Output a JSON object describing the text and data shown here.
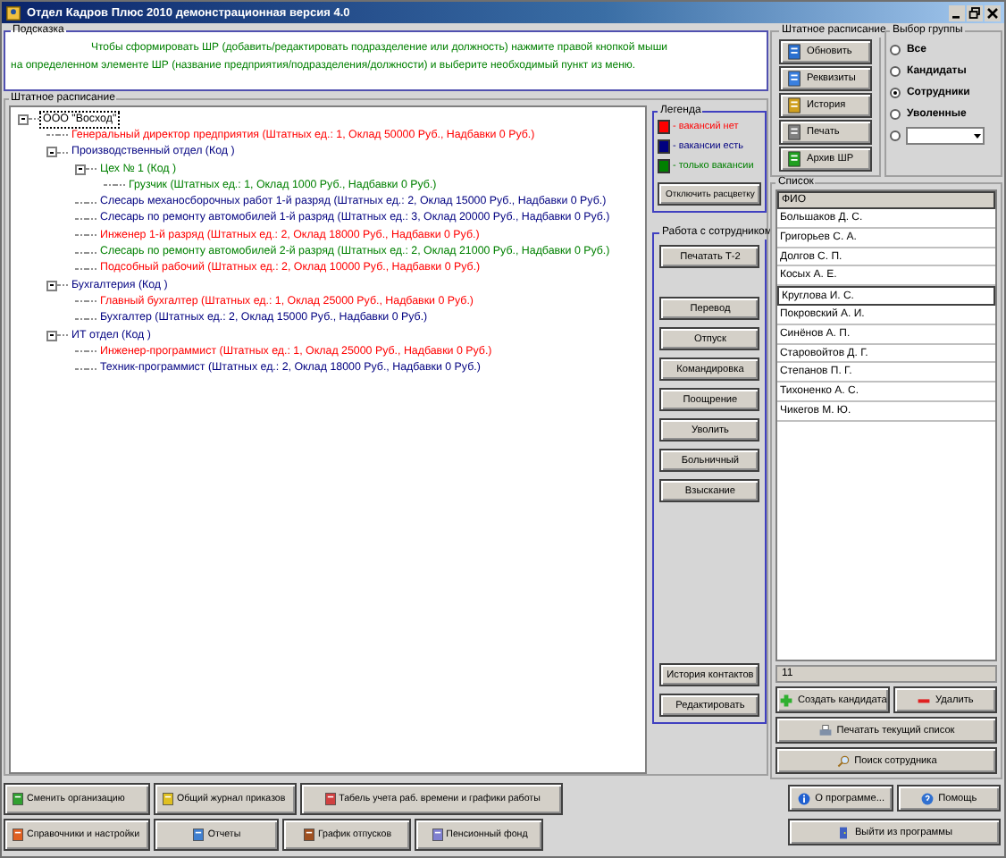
{
  "window": {
    "title": "Отдел Кадров Плюс 2010 демонстрационная версия 4.0"
  },
  "hint": {
    "title": "Подсказка",
    "text": "Чтобы сформировать ШР (добавить/редактировать подразделение или должность) нажмите правой кнопкой мыши на определенном элементе ШР (название предприятия/подразделения/должности) и выберите необходимый пункт из меню."
  },
  "staffing": {
    "title": "Штатное расписание",
    "tree": [
      {
        "label": "ООО \"Восход\"",
        "color": "#000000",
        "selected": true,
        "expanded": true,
        "children": [
          {
            "label": "Генеральный директор предприятия (Штатных ед.: 1, Оклад 50000 Руб., Надбавки 0 Руб.)",
            "color": "#ff0000",
            "selected": false
          },
          {
            "label": "Производственный отдел (Код )",
            "color": "#000080",
            "selected": false,
            "expanded": true,
            "children": [
              {
                "label": "Цех № 1 (Код )",
                "color": "#008000",
                "selected": false,
                "expanded": true,
                "children": [
                  {
                    "label": "Грузчик (Штатных ед.: 1, Оклад 1000 Руб., Надбавки 0 Руб.)",
                    "color": "#008000",
                    "selected": false
                  }
                ]
              },
              {
                "label": "Слесарь механосборочных работ 1-й разряд (Штатных ед.: 2, Оклад 15000 Руб., Надбавки 0 Руб.)",
                "color": "#000080",
                "selected": false
              },
              {
                "label": "Слесарь по ремонту автомобилей 1-й разряд (Штатных ед.: 3, Оклад 20000 Руб., Надбавки 0 Руб.)",
                "color": "#000080",
                "selected": false
              },
              {
                "label": "Инженер 1-й разряд (Штатных ед.: 2, Оклад 18000 Руб., Надбавки 0 Руб.)",
                "color": "#ff0000",
                "selected": false
              },
              {
                "label": "Слесарь по ремонту автомобилей 2-й разряд (Штатных ед.: 2, Оклад 21000 Руб., Надбавки 0 Руб.)",
                "color": "#008000",
                "selected": false
              },
              {
                "label": "Подсобный рабочий (Штатных ед.: 2, Оклад 10000 Руб., Надбавки 0 Руб.)",
                "color": "#ff0000",
                "selected": false
              }
            ]
          },
          {
            "label": "Бухгалтерия (Код )",
            "color": "#000080",
            "selected": false,
            "expanded": true,
            "children": [
              {
                "label": "Главный бухгалтер (Штатных ед.: 1, Оклад 25000 Руб., Надбавки 0 Руб.)",
                "color": "#ff0000",
                "selected": false
              },
              {
                "label": "Бухгалтер (Штатных ед.: 2, Оклад 15000 Руб., Надбавки 0 Руб.)",
                "color": "#000080",
                "selected": false
              }
            ]
          },
          {
            "label": "ИТ отдел (Код )",
            "color": "#000080",
            "selected": false,
            "expanded": true,
            "children": [
              {
                "label": "Инженер-программист (Штатных ед.: 1, Оклад 25000 Руб., Надбавки 0 Руб.)",
                "color": "#ff0000",
                "selected": false
              },
              {
                "label": "Техник-программист (Штатных ед.: 2, Оклад 18000 Руб., Надбавки 0 Руб.)",
                "color": "#000080",
                "selected": false
              }
            ]
          }
        ]
      }
    ]
  },
  "legend": {
    "title": "Легенда",
    "items": [
      {
        "label": "- вакансий нет",
        "color": "#ff0000"
      },
      {
        "label": "- вакансии есть",
        "color": "#000080"
      },
      {
        "label": "- только вакансии",
        "color": "#008000"
      }
    ],
    "button": "Отключить расцветку"
  },
  "employee_actions": {
    "title": "Работа с сотрудником",
    "top": [
      "Печатать Т-2"
    ],
    "middle": [
      "Перевод",
      "Отпуск",
      "Командировка",
      "Поощрение",
      "Уволить",
      "Больничный",
      "Взыскание"
    ],
    "bottom": [
      "История контактов",
      "Редактировать"
    ]
  },
  "staff_panel": {
    "title": "Штатное расписание",
    "buttons": [
      "Обновить",
      "Реквизиты",
      "История",
      "Печать",
      "Архив ШР"
    ]
  },
  "group_select": {
    "title": "Выбор группы",
    "options": [
      {
        "kind": "radio",
        "label": "Все",
        "selected": false
      },
      {
        "kind": "radio",
        "label": "Кандидаты",
        "selected": false
      },
      {
        "kind": "radio",
        "label": "Сотрудники",
        "selected": true
      },
      {
        "kind": "radio",
        "label": "Уволенные",
        "selected": false
      },
      {
        "kind": "dropdown",
        "selected": false
      }
    ]
  },
  "list": {
    "title": "Список",
    "column": "ФИО",
    "rows": [
      {
        "name": "Большаков Д. С.",
        "selected": false
      },
      {
        "name": "Григорьев С. А.",
        "selected": false
      },
      {
        "name": "Долгов С. П.",
        "selected": false
      },
      {
        "name": "Косых А. Е.",
        "selected": false
      },
      {
        "name": "Круглова И. С.",
        "selected": true
      },
      {
        "name": "Покровский А. И.",
        "selected": false
      },
      {
        "name": "Синёнов А. П.",
        "selected": false
      },
      {
        "name": "Старовойтов Д. Г.",
        "selected": false
      },
      {
        "name": "Степанов П. Г.",
        "selected": false
      },
      {
        "name": "Тихоненко А. С.",
        "selected": false
      },
      {
        "name": "Чикегов М. Ю.",
        "selected": false
      }
    ],
    "count": "11"
  },
  "list_buttons": {
    "create": "Создать кандидата",
    "delete": "Удалить",
    "print": "Печатать текущий список",
    "search": "Поиск сотрудника"
  },
  "app_buttons": {
    "about": "О программе...",
    "help": "Помощь",
    "exit": "Выйти из программы"
  },
  "toolbar": {
    "row_1": [
      "Сменить организацию",
      "Общий журнал приказов",
      "Табель учета раб. времени и графики работы"
    ],
    "row_2": [
      "Справочники и настройки",
      "Отчеты",
      "График отпусков",
      "Пенсионный фонд"
    ]
  }
}
